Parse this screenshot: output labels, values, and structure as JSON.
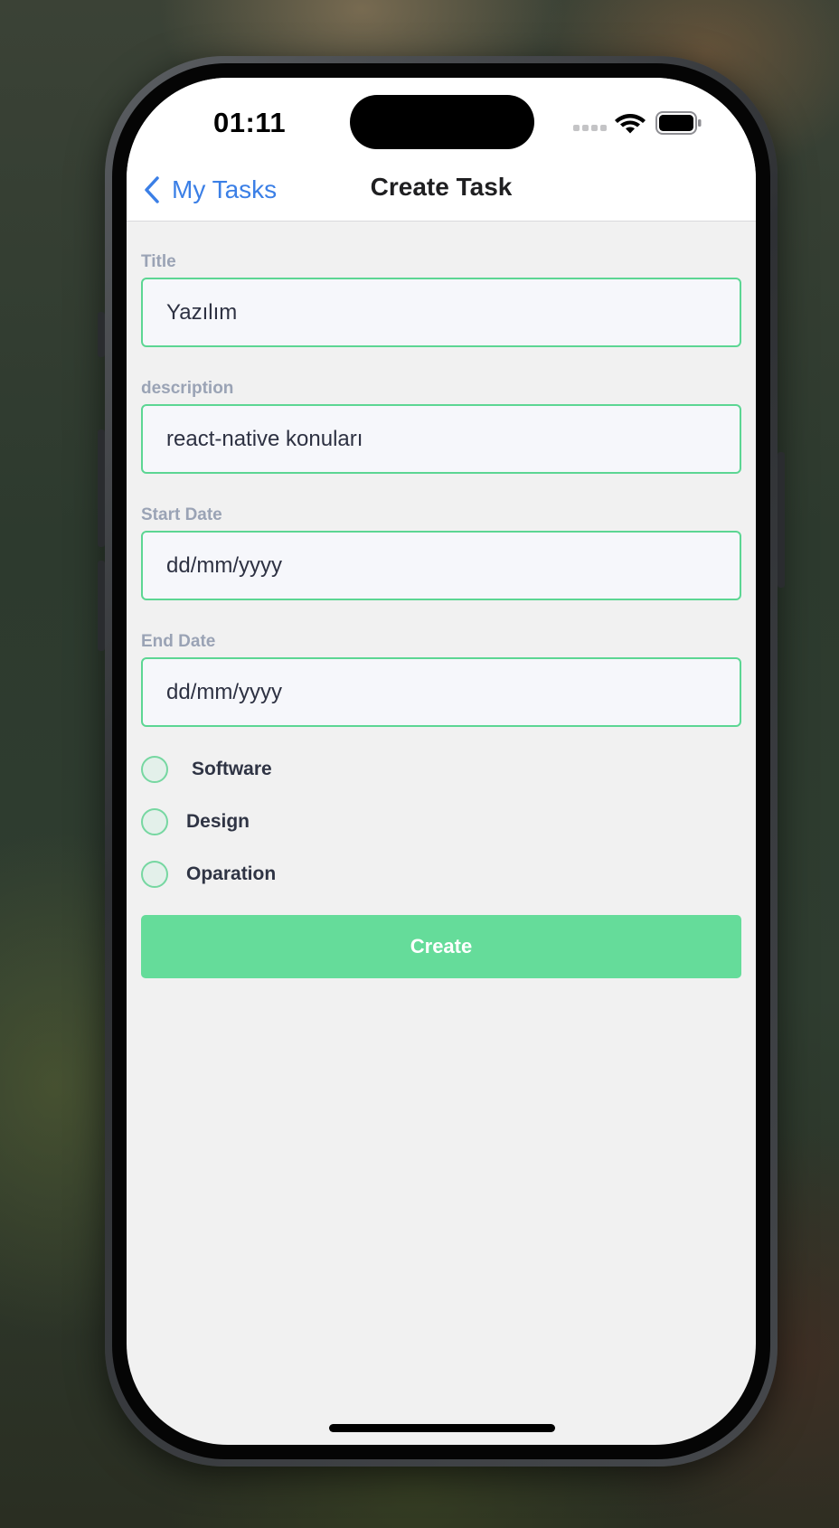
{
  "status_bar": {
    "time": "01:11",
    "wifi_icon": "wifi-icon",
    "battery_icon": "battery-icon"
  },
  "nav": {
    "back_label": "My Tasks",
    "back_icon": "chevron-left-icon",
    "title": "Create Task"
  },
  "form": {
    "title": {
      "label": "Title",
      "value": "Yazılım",
      "placeholder": ""
    },
    "description": {
      "label": "description",
      "value": "react-native konuları",
      "placeholder": ""
    },
    "start_date": {
      "label": "Start Date",
      "value": "",
      "placeholder": "dd/mm/yyyy"
    },
    "end_date": {
      "label": "End Date",
      "value": "",
      "placeholder": "dd/mm/yyyy"
    },
    "categories": [
      {
        "label": "Software",
        "selected": false
      },
      {
        "label": "Design",
        "selected": false
      },
      {
        "label": "Oparation",
        "selected": false
      }
    ],
    "submit_label": "Create"
  },
  "colors": {
    "accent_green": "#65dc9a",
    "input_border": "#5cd693",
    "link_blue": "#3b7fe6",
    "label_gray": "#9aa3b5"
  }
}
